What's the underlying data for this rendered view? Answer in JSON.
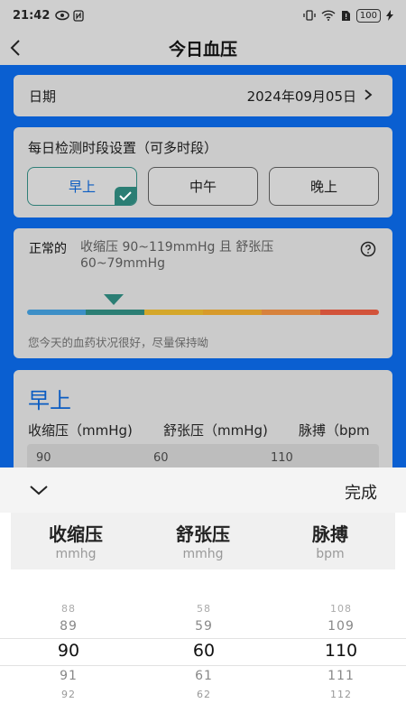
{
  "status_bar": {
    "time": "21:42",
    "battery": "100"
  },
  "nav": {
    "title": "今日血压"
  },
  "date": {
    "label": "日期",
    "value": "2024年09月05日"
  },
  "period": {
    "title": "每日检测时段设置（可多时段）",
    "options": [
      {
        "label": "早上",
        "selected": true
      },
      {
        "label": "中午",
        "selected": false
      },
      {
        "label": "晚上",
        "selected": false
      }
    ]
  },
  "bp_status": {
    "status": "正常的",
    "description": "收缩压 90~119mmHg 且 舒张压 60~79mmHg",
    "advice": "您今天的血药状况很好，尽量保持呦",
    "scale_colors": [
      "#3d8fc7",
      "#2b7e74",
      "#d4a72a",
      "#d79a2b",
      "#d7823c",
      "#d2533a"
    ]
  },
  "reading": {
    "heading": "早上",
    "columns": [
      "收缩压（mmHg)",
      "舒张压（mmHg)",
      "脉搏（bpm"
    ],
    "values": [
      "90",
      "60",
      "110"
    ]
  },
  "picker": {
    "done_label": "完成",
    "columns": [
      {
        "title": "收缩压",
        "unit": "mmhg",
        "items": [
          "88",
          "89",
          "90",
          "91",
          "92"
        ]
      },
      {
        "title": "舒张压",
        "unit": "mmhg",
        "items": [
          "58",
          "59",
          "60",
          "61",
          "62"
        ]
      },
      {
        "title": "脉搏",
        "unit": "bpm",
        "items": [
          "108",
          "109",
          "110",
          "111",
          "112"
        ]
      }
    ]
  }
}
